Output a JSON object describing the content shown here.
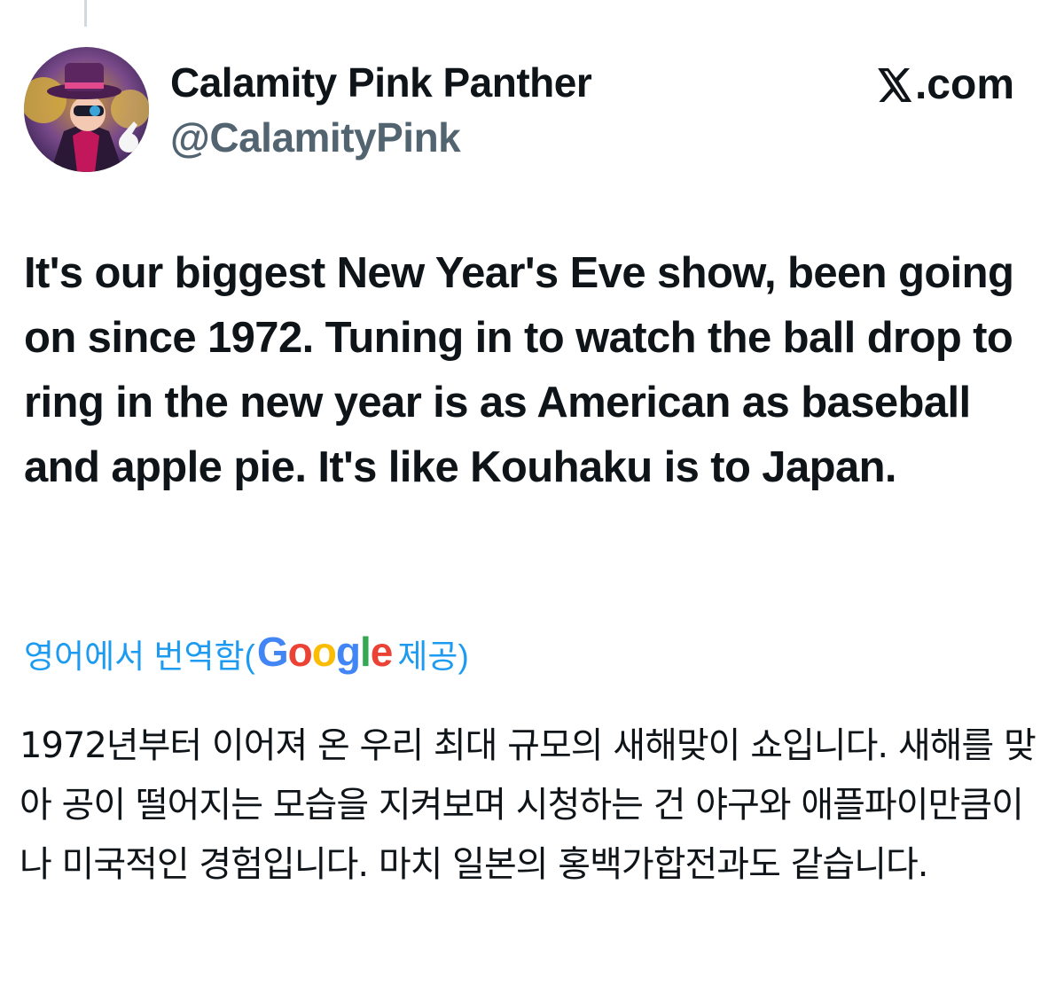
{
  "author": {
    "display_name": "Calamity Pink Panther",
    "handle": "@CalamityPink"
  },
  "brand": {
    "label": ".com"
  },
  "tweet": {
    "text": "It's our biggest New Year's Eve show, been going on since 1972. Tuning in to watch the ball drop to ring in the new year is as American as baseball and apple pie. It's like Kouhaku is to Japan."
  },
  "translation": {
    "prefix": "영어에서 번역함(",
    "provider": "Google",
    "suffix": " 제공)",
    "text": "1972년부터 이어져 온 우리 최대 규모의 새해맞이 쇼입니다. 새해를 맞아 공이 떨어지는 모습을 지켜보며 시청하는 건 야구와 애플파이만큼이나 미국적인 경험입니다. 마치 일본의 홍백가합전과도 같습니다."
  },
  "colors": {
    "text": "#0f1419",
    "secondary": "#536471",
    "link": "#1d9bf0"
  },
  "icons": {
    "logo": "x-logo-icon",
    "avatar": "profile-avatar"
  }
}
